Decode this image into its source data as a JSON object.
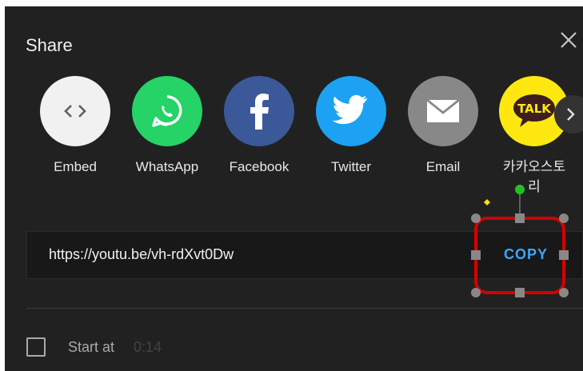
{
  "dialog": {
    "title": "Share",
    "close_icon": "close-icon"
  },
  "share_targets": [
    {
      "label": "Embed",
      "icon": "embed-icon",
      "color": "#f1f1f1"
    },
    {
      "label": "WhatsApp",
      "icon": "whatsapp-icon",
      "color": "#25d366"
    },
    {
      "label": "Facebook",
      "icon": "facebook-icon",
      "color": "#3b5998"
    },
    {
      "label": "Twitter",
      "icon": "twitter-icon",
      "color": "#1da1f2"
    },
    {
      "label": "Email",
      "icon": "email-icon",
      "color": "#888888"
    },
    {
      "label": "카카오스토리",
      "icon": "kakaotalk-icon",
      "color": "#ffe812",
      "logo_text": "TALK"
    }
  ],
  "next_icon": "chevron-right-icon",
  "link": {
    "url": "https://youtu.be/vh-rdXvt0Dw",
    "copy_label": "COPY"
  },
  "start_at": {
    "label": "Start at",
    "time": "0:14",
    "checked": false
  },
  "annotation": {
    "highlight_color": "#d40000"
  }
}
